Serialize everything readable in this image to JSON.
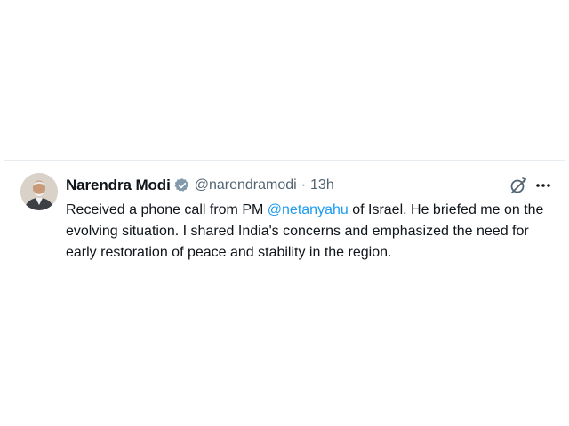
{
  "tweet": {
    "author": {
      "display_name": "Narendra Modi",
      "handle": "@narendramodi",
      "verified_color": "#829aab"
    },
    "separator": "·",
    "time": "13h",
    "text": {
      "line1_prefix": "Received a phone call from PM ",
      "mention": "@netanyahu",
      "line1_suffix": " of Israel. He briefed me on the",
      "line2": "evolving situation. I shared India's concerns and emphasized the need for",
      "line3": "early restoration of peace and stability in the region."
    },
    "icons": {
      "verified": "verified-badge-icon",
      "grok": "grok-icon",
      "more": "more-options-icon"
    }
  },
  "colors": {
    "text": "#0f1419",
    "secondary": "#536471",
    "mention": "#1d9bf0",
    "border": "#e6ecf0"
  }
}
